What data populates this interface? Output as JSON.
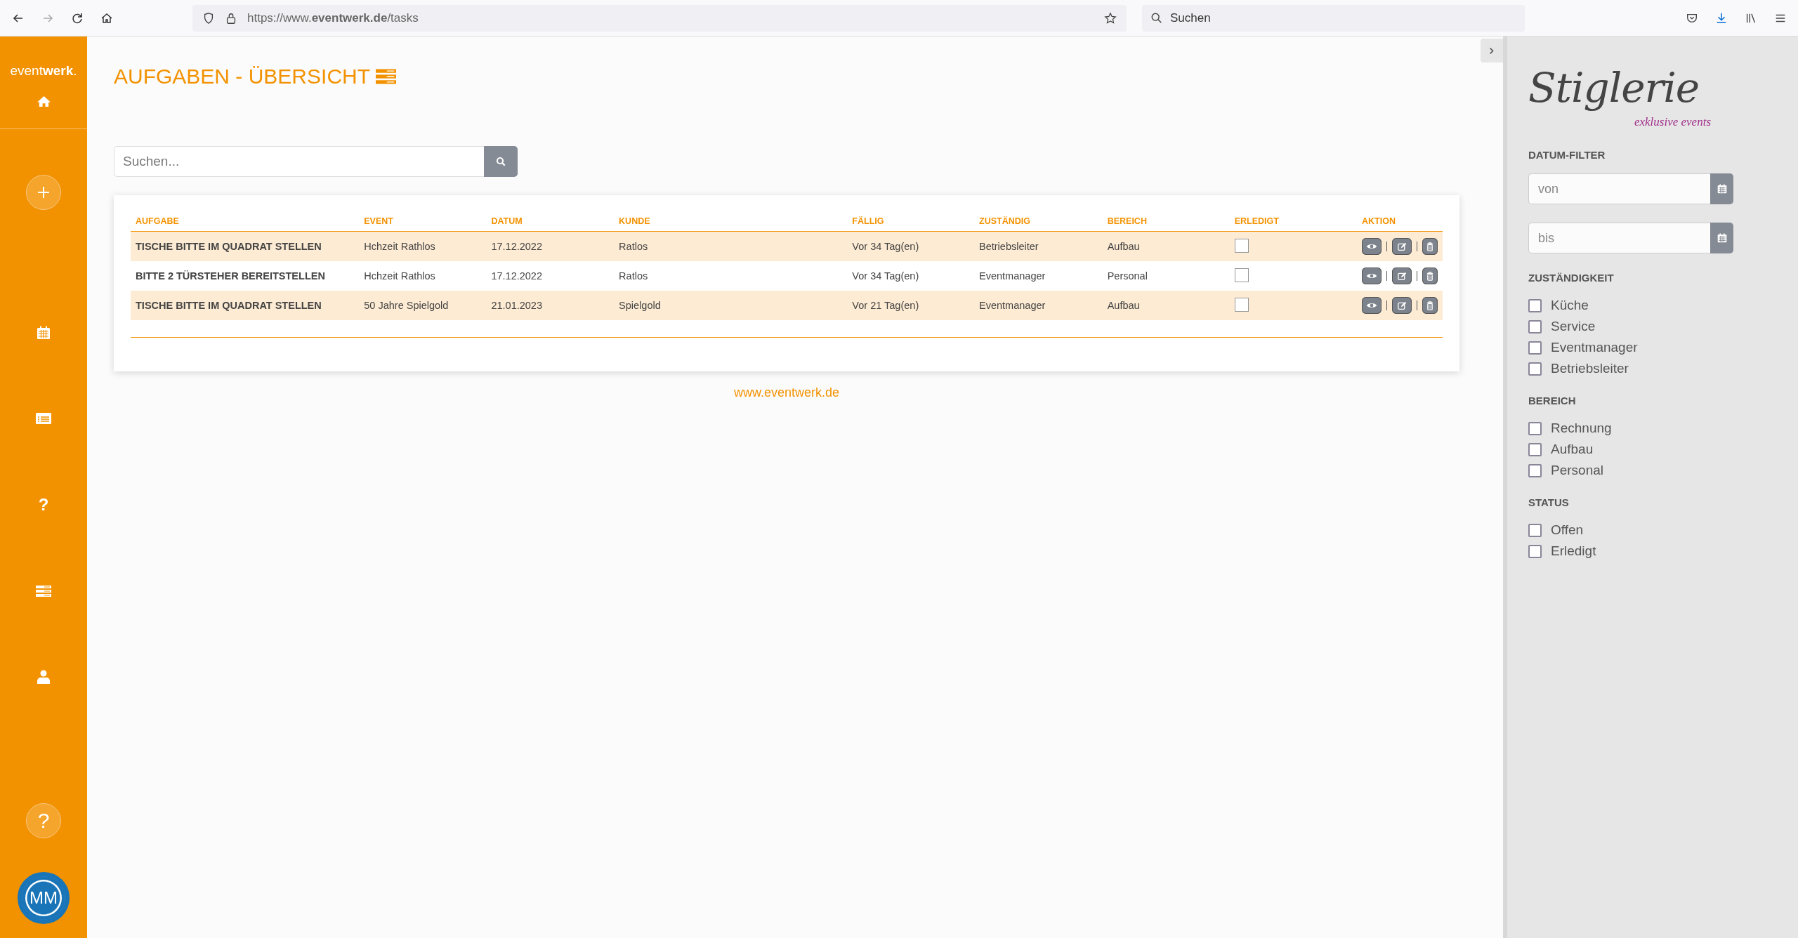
{
  "browser": {
    "url": "https://www.**eventwerk.de**/tasks",
    "search_placeholder": "Suchen"
  },
  "sidebar": {
    "logo": "event**werk**.",
    "nav": [
      {
        "kind": "plus"
      },
      {
        "kind": "calendar"
      },
      {
        "kind": "list"
      },
      {
        "kind": "question",
        "glyph": "?"
      },
      {
        "kind": "stack"
      },
      {
        "kind": "user"
      }
    ],
    "help": "?",
    "avatar": "MM"
  },
  "main": {
    "title": "AUFGABEN - ÜBERSICHT",
    "search": {
      "placeholder": "Suchen..."
    },
    "table": {
      "columns": [
        "AUFGABE",
        "EVENT",
        "DATUM",
        "KUNDE",
        "FÄLLIG",
        "ZUSTÄNDIG",
        "BEREICH",
        "ERLEDIGT",
        "AKTION"
      ],
      "rows": [
        {
          "cells": [
            "TISCHE BITTE IM QUADRAT STELLEN",
            "Hchzeit Rathlos",
            "17.12.2022",
            "Ratlos",
            "Vor 34 Tag(en)",
            "Betriebsleiter",
            "Aufbau"
          ],
          "done": false
        },
        {
          "cells": [
            "BITTE 2 TÜRSTEHER BEREITSTELLEN",
            "Hchzeit Rathlos",
            "17.12.2022",
            "Ratlos",
            "Vor 34 Tag(en)",
            "Eventmanager",
            "Personal"
          ],
          "done": false
        },
        {
          "cells": [
            "TISCHE BITTE IM QUADRAT STELLEN",
            "50 Jahre Spielgold",
            "21.01.2023",
            "Spielgold",
            "Vor 21 Tag(en)",
            "Eventmanager",
            "Aufbau"
          ],
          "done": false
        }
      ]
    },
    "footer": "www.eventwerk.de"
  },
  "filters": {
    "logo": {
      "name": "Stiglerie",
      "tagline": "exklusive events"
    },
    "sections": [
      {
        "kind": "dates",
        "title": "DATUM-FILTER",
        "fields": [
          {
            "placeholder": "von"
          },
          {
            "placeholder": "bis"
          }
        ]
      },
      {
        "kind": "checks",
        "title": "ZUSTÄNDIGKEIT",
        "options": [
          {
            "label": "Küche",
            "checked": false
          },
          {
            "label": "Service",
            "checked": false
          },
          {
            "label": "Eventmanager",
            "checked": false
          },
          {
            "label": "Betriebsleiter",
            "checked": false
          }
        ]
      },
      {
        "kind": "checks",
        "title": "BEREICH",
        "options": [
          {
            "label": "Rechnung",
            "checked": false
          },
          {
            "label": "Aufbau",
            "checked": false
          },
          {
            "label": "Personal",
            "checked": false
          }
        ]
      },
      {
        "kind": "checks",
        "title": "STATUS",
        "options": [
          {
            "label": "Offen",
            "checked": false
          },
          {
            "label": "Erledigt",
            "checked": false
          }
        ]
      }
    ]
  }
}
